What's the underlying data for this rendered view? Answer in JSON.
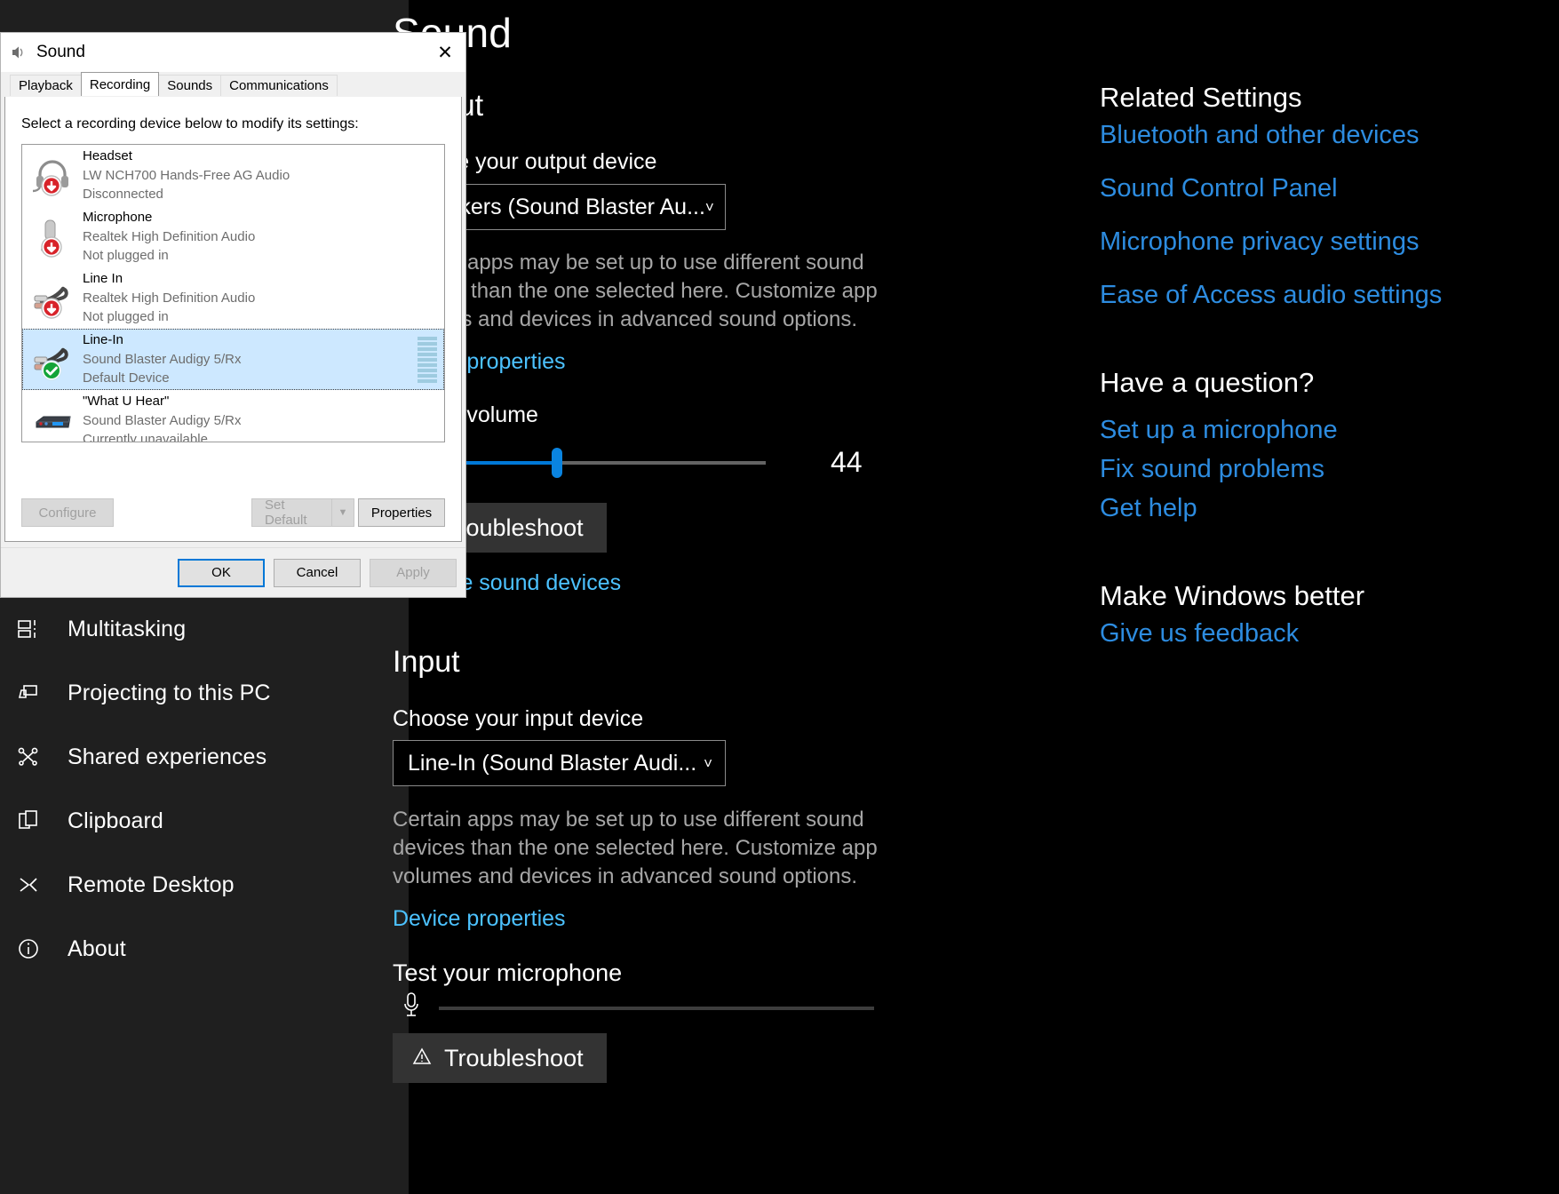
{
  "settings": {
    "page_title": "Sound",
    "sidebar": {
      "items": [
        {
          "label": "Multitasking",
          "icon": "multitasking-icon"
        },
        {
          "label": "Projecting to this PC",
          "icon": "projecting-icon"
        },
        {
          "label": "Shared experiences",
          "icon": "shared-experiences-icon"
        },
        {
          "label": "Clipboard",
          "icon": "clipboard-icon"
        },
        {
          "label": "Remote Desktop",
          "icon": "remote-desktop-icon"
        },
        {
          "label": "About",
          "icon": "info-icon"
        }
      ]
    },
    "output": {
      "heading": "Output",
      "choose_label": "Choose your output device",
      "device_value": "Speakers (Sound Blaster Au...",
      "description": "Certain apps may be set up to use different sound devices than the one selected here. Customize app volumes and devices in advanced sound options.",
      "device_properties_link": "Device properties",
      "volume_label": "Master volume",
      "volume_value": "44",
      "troubleshoot_label": "Troubleshoot",
      "manage_link": "Manage sound devices"
    },
    "input": {
      "heading": "Input",
      "choose_label": "Choose your input device",
      "device_value": "Line-In (Sound Blaster Audi...",
      "description": "Certain apps may be set up to use different sound devices than the one selected here. Customize app volumes and devices in advanced sound options.",
      "device_properties_link": "Device properties",
      "test_label": "Test your microphone",
      "troubleshoot_label": "Troubleshoot"
    },
    "rail": {
      "related_heading": "Related Settings",
      "related_links": [
        "Bluetooth and other devices",
        "Sound Control Panel",
        "Microphone privacy settings",
        "Ease of Access audio settings"
      ],
      "question_heading": "Have a question?",
      "question_links": [
        "Set up a microphone",
        "Fix sound problems",
        "Get help"
      ],
      "feedback_heading": "Make Windows better",
      "feedback_link": "Give us feedback"
    },
    "colors": {
      "accent": "#0078d7",
      "link": "#4cc2ff",
      "rail_link": "#2d8ce0",
      "muted_text": "#a6a6a6"
    }
  },
  "dialog": {
    "title": "Sound",
    "close_label": "✕",
    "tabs": [
      {
        "label": "Playback",
        "active": false
      },
      {
        "label": "Recording",
        "active": true
      },
      {
        "label": "Sounds",
        "active": false
      },
      {
        "label": "Communications",
        "active": false
      }
    ],
    "instruction": "Select a recording device below to modify its settings:",
    "devices": [
      {
        "name": "Headset",
        "driver": "LW NCH700 Hands-Free AG Audio",
        "status": "Disconnected",
        "icon": "headset-icon",
        "badge": "red-down-arrow",
        "selected": false,
        "meter": 0
      },
      {
        "name": "Microphone",
        "driver": "Realtek High Definition Audio",
        "status": "Not plugged in",
        "icon": "microphone-icon",
        "badge": "red-down-arrow",
        "selected": false,
        "meter": 0
      },
      {
        "name": "Line In",
        "driver": "Realtek High Definition Audio",
        "status": "Not plugged in",
        "icon": "line-in-icon",
        "badge": "red-down-arrow",
        "selected": false,
        "meter": 0
      },
      {
        "name": "Line-In",
        "driver": "Sound Blaster Audigy 5/Rx",
        "status": "Default Device",
        "icon": "line-in-icon",
        "badge": "green-check",
        "selected": true,
        "meter": 9
      },
      {
        "name": "\"What U Hear\"",
        "driver": "Sound Blaster Audigy 5/Rx",
        "status": "Currently unavailable",
        "icon": "device-box-icon",
        "badge": "none",
        "selected": false,
        "meter": 0
      }
    ],
    "buttons": {
      "configure": "Configure",
      "set_default": "Set Default",
      "properties": "Properties",
      "ok": "OK",
      "cancel": "Cancel",
      "apply": "Apply"
    }
  }
}
